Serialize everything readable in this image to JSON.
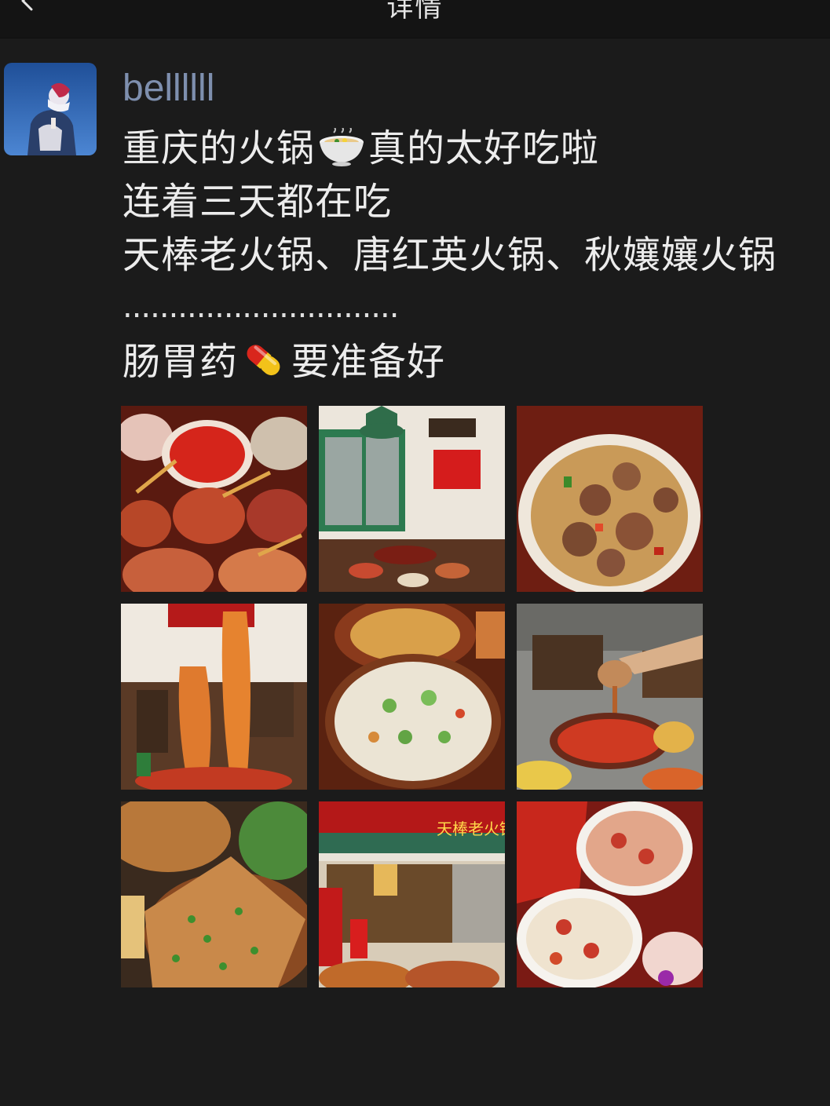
{
  "header": {
    "title": "详情",
    "back_icon": "chevron-left-icon"
  },
  "post": {
    "username": "bellllll",
    "avatar_icon": "user-avatar",
    "lines": [
      "重庆的火锅",
      "真的太好吃啦",
      "连着三天都在吃",
      "天棒老火锅、唐红英火锅、秋孃孃火锅",
      "..............................",
      "肠胃药",
      "要准备好"
    ],
    "emojis": {
      "line1": "hotpot-bowl-emoji",
      "line5": "pill-emoji"
    },
    "images": [
      {
        "name": "photo-hotpot-ingredients",
        "colors": [
          "#7a1a10",
          "#d8462a",
          "#c98a55"
        ]
      },
      {
        "name": "photo-restaurant-interior",
        "colors": [
          "#e8e3da",
          "#2f7d52",
          "#5a3322"
        ],
        "signs": [
          "",
          ""
        ]
      },
      {
        "name": "photo-spicy-chicken-rice",
        "colors": [
          "#7b2a1a",
          "#c9a15c",
          "#8e5a3b"
        ]
      },
      {
        "name": "photo-noodles-lift",
        "colors": [
          "#efe9e0",
          "#d86b2a",
          "#4a3322"
        ]
      },
      {
        "name": "photo-fried-rice-bowl",
        "colors": [
          "#6a2a12",
          "#e9e2d3",
          "#7ab65a"
        ]
      },
      {
        "name": "photo-pouring-soup",
        "colors": [
          "#4a3a2a",
          "#c9412a",
          "#e8c85a"
        ]
      },
      {
        "name": "photo-scallion-pancake",
        "colors": [
          "#5a3a22",
          "#c98a44",
          "#3d8a2a"
        ]
      },
      {
        "name": "photo-storefront-tianbang",
        "colors": [
          "#b01818",
          "#2f6b52",
          "#e6d9c2"
        ],
        "signs": [
          "",
          "天棒老火锅"
        ]
      },
      {
        "name": "photo-bingfen-dessert",
        "colors": [
          "#b12018",
          "#f1e4cf",
          "#c7352a"
        ]
      }
    ]
  }
}
